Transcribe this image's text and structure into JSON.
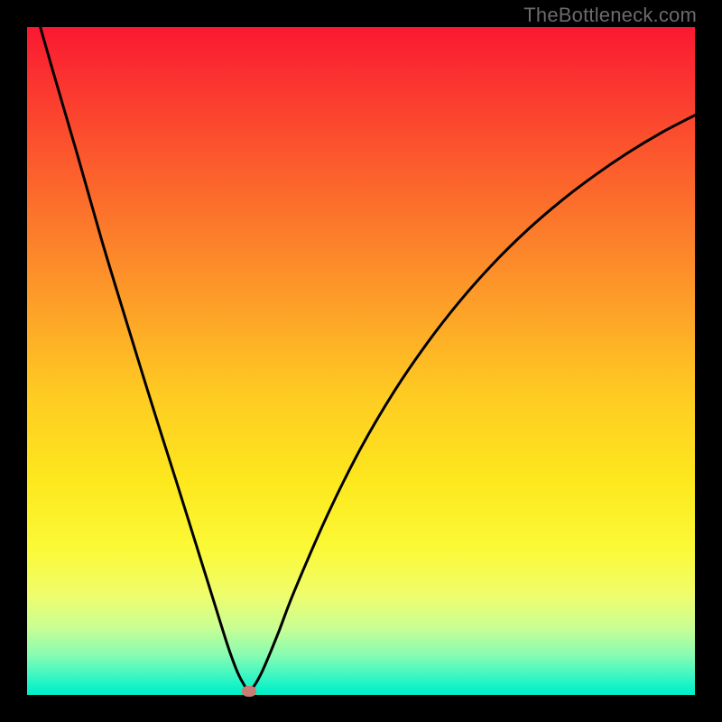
{
  "watermark": "TheBottleneck.com",
  "colors": {
    "frame": "#000000",
    "curve": "#000000",
    "marker": "#c87c73"
  },
  "chart_data": {
    "type": "line",
    "title": "",
    "xlabel": "",
    "ylabel": "",
    "xlim": [
      0,
      100
    ],
    "ylim": [
      0,
      100
    ],
    "grid": false,
    "legend": false,
    "series": [
      {
        "name": "bottleneck-curve",
        "x": [
          0,
          3.7,
          7.5,
          11.2,
          15,
          18.7,
          22.5,
          25,
          27.5,
          30,
          31.5,
          32.5,
          33.3,
          35,
          37.5,
          40,
          45,
          50,
          55,
          60,
          65,
          70,
          75,
          80,
          85,
          90,
          95,
          100
        ],
        "values": [
          107,
          94,
          81,
          68,
          55.5,
          43.5,
          31.5,
          23.5,
          15.5,
          7.5,
          3.4,
          1.5,
          0.6,
          3.1,
          9.0,
          15.5,
          27.0,
          37.0,
          45.5,
          52.8,
          59.2,
          64.8,
          69.7,
          74.0,
          77.8,
          81.2,
          84.2,
          86.8
        ]
      }
    ],
    "annotations": [
      {
        "name": "optimal-marker",
        "x": 33.3,
        "y": 0.6
      }
    ]
  }
}
